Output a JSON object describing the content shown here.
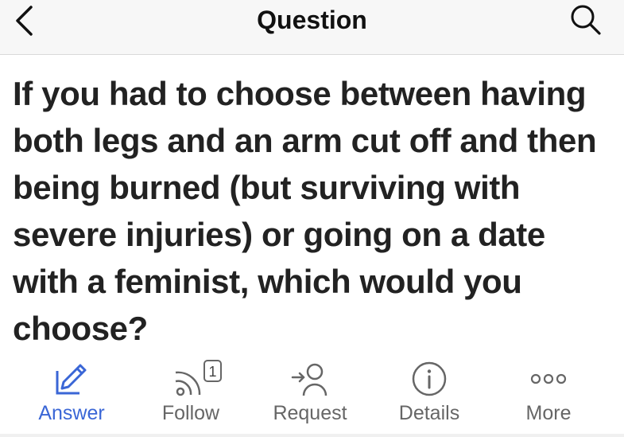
{
  "header": {
    "title": "Question",
    "back_icon": "chevron-left-icon",
    "search_icon": "search-icon"
  },
  "question": {
    "text": "If you had to choose between having both legs and an arm cut off and then being burned (but surviving with severe injuries) or going on a date with a feminist, which would you choose?"
  },
  "actions": {
    "answer": {
      "label": "Answer",
      "icon": "edit-icon",
      "active": true,
      "color": "#3a66d6"
    },
    "follow": {
      "label": "Follow",
      "icon": "rss-icon",
      "badge": "1"
    },
    "request": {
      "label": "Request",
      "icon": "request-user-icon"
    },
    "details": {
      "label": "Details",
      "icon": "info-icon"
    },
    "more": {
      "label": "More",
      "icon": "more-icon"
    }
  },
  "colors": {
    "accent": "#3a66d6",
    "text": "#222222",
    "muted": "#666666",
    "header_bg": "#f7f7f7"
  }
}
